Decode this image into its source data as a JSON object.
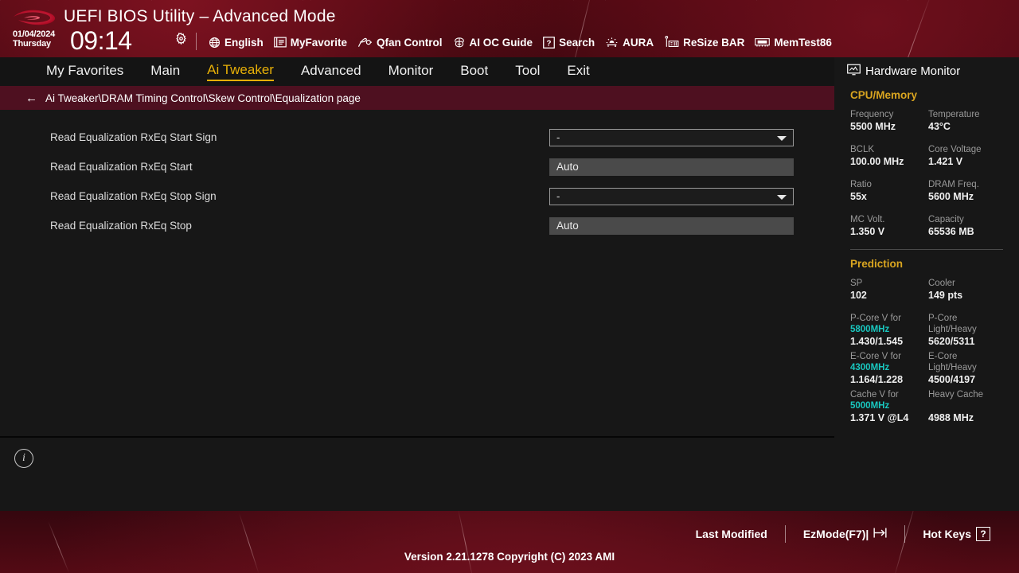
{
  "header": {
    "title": "UEFI BIOS Utility – Advanced Mode",
    "logo_icon": "rog-logo",
    "date": "01/04/2024",
    "weekday": "Thursday",
    "time": "09:14",
    "gear_icon": "gear-icon",
    "menu": [
      {
        "label": "English",
        "icon": "globe-icon"
      },
      {
        "label": "MyFavorite",
        "icon": "favorites-list-icon"
      },
      {
        "label": "Qfan Control",
        "icon": "fan-icon"
      },
      {
        "label": "AI OC Guide",
        "icon": "ai-chip-icon"
      },
      {
        "label": "Search",
        "icon": "question-box-icon"
      },
      {
        "label": "AURA",
        "icon": "aura-light-icon"
      },
      {
        "label": "ReSize BAR",
        "icon": "resize-bar-icon"
      },
      {
        "label": "MemTest86",
        "icon": "memory-module-icon"
      }
    ]
  },
  "nav": {
    "tabs": [
      {
        "label": "My Favorites",
        "active": false
      },
      {
        "label": "Main",
        "active": false
      },
      {
        "label": "Ai Tweaker",
        "active": true
      },
      {
        "label": "Advanced",
        "active": false
      },
      {
        "label": "Monitor",
        "active": false
      },
      {
        "label": "Boot",
        "active": false
      },
      {
        "label": "Tool",
        "active": false
      },
      {
        "label": "Exit",
        "active": false
      }
    ],
    "active_color": "#e8b007"
  },
  "breadcrumb": {
    "back_icon": "back-arrow-icon",
    "path": "Ai Tweaker\\DRAM Timing Control\\Skew Control\\Equalization page"
  },
  "settings": [
    {
      "label": "Read Equalization RxEq Start Sign",
      "value": "-",
      "type": "select"
    },
    {
      "label": "Read Equalization RxEq Start",
      "value": "Auto",
      "type": "text"
    },
    {
      "label": "Read Equalization RxEq Stop Sign",
      "value": "-",
      "type": "select"
    },
    {
      "label": "Read Equalization RxEq Stop",
      "value": "Auto",
      "type": "text"
    }
  ],
  "help": {
    "info_icon": "info-icon",
    "text": ""
  },
  "hardware_monitor": {
    "title": "Hardware Monitor",
    "title_icon": "monitor-icon",
    "sections": [
      {
        "name": "CPU/Memory",
        "color": "#d9a520",
        "pairs": [
          {
            "left_key": "Frequency",
            "left_value": "5500 MHz",
            "right_key": "Temperature",
            "right_value": "43°C"
          },
          {
            "left_key": "BCLK",
            "left_value": "100.00 MHz",
            "right_key": "Core Voltage",
            "right_value": "1.421 V"
          },
          {
            "left_key": "Ratio",
            "left_value": "55x",
            "right_key": "DRAM Freq.",
            "right_value": "5600 MHz"
          },
          {
            "left_key": "MC Volt.",
            "left_value": "1.350 V",
            "right_key": "Capacity",
            "right_value": "65536 MB"
          }
        ]
      },
      {
        "name": "Prediction",
        "color": "#d9a520",
        "pairs": [
          {
            "left_key": "SP",
            "left_value": "102",
            "right_key": "Cooler",
            "right_value": "149 pts"
          }
        ],
        "detail_rows": [
          {
            "left_key": "P-Core V for",
            "left_key2": "5800MHz",
            "left_value": "1.430/1.545",
            "right_key": "P-Core",
            "right_key2": "Light/Heavy",
            "right_value": "5620/5311"
          },
          {
            "left_key": "E-Core V for",
            "left_key2": "4300MHz",
            "left_value": "1.164/1.228",
            "right_key": "E-Core",
            "right_key2": "Light/Heavy",
            "right_value": "4500/4197"
          },
          {
            "left_key": "Cache V for",
            "left_key2": "5000MHz",
            "left_value": "1.371 V @L4",
            "right_key": "Heavy Cache",
            "right_key2": "",
            "right_value": "4988 MHz"
          }
        ],
        "highlight_color": "#19c8c0"
      }
    ]
  },
  "footer": {
    "items": [
      {
        "label": "Last Modified",
        "icon": ""
      },
      {
        "label": "EzMode(F7)|",
        "icon": "exit-arrow-icon"
      },
      {
        "label": "Hot Keys",
        "icon": "question-box-icon"
      }
    ],
    "version": "Version 2.21.1278 Copyright (C) 2023 AMI"
  }
}
